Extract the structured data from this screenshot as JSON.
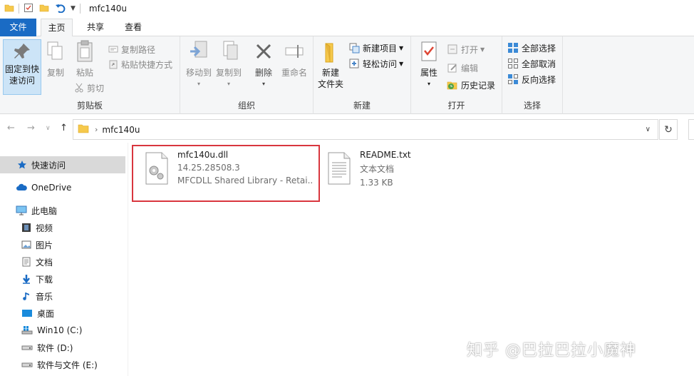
{
  "window": {
    "title": "mfc140u"
  },
  "tabs": {
    "file": "文件",
    "home": "主页",
    "share": "共享",
    "view": "查看"
  },
  "ribbon": {
    "clipboard": {
      "label": "剪贴板",
      "pin": "固定到快速访问",
      "pin_line1": "固定到快",
      "pin_line2": "速访问",
      "copy": "复制",
      "paste": "粘贴",
      "copy_path": "复制路径",
      "paste_shortcut": "粘贴快捷方式",
      "cut": "剪切"
    },
    "organize": {
      "label": "组织",
      "move_to": "移动到",
      "copy_to": "复制到",
      "delete": "删除",
      "rename": "重命名"
    },
    "new": {
      "label": "新建",
      "new_folder_line1": "新建",
      "new_folder_line2": "文件夹",
      "new_item": "新建项目",
      "easy_access": "轻松访问"
    },
    "open": {
      "label": "打开",
      "properties": "属性",
      "open": "打开",
      "edit": "编辑",
      "history": "历史记录"
    },
    "select": {
      "label": "选择",
      "select_all": "全部选择",
      "select_none": "全部取消",
      "invert": "反向选择"
    }
  },
  "address": {
    "path": "mfc140u"
  },
  "nav": {
    "quick_access": "快速访问",
    "onedrive": "OneDrive",
    "this_pc": "此电脑",
    "videos": "视频",
    "pictures": "图片",
    "documents": "文档",
    "downloads": "下载",
    "music": "音乐",
    "desktop": "桌面",
    "drive_c": "Win10 (C:)",
    "drive_d": "软件 (D:)",
    "drive_e": "软件与文件 (E:)"
  },
  "files": [
    {
      "name": "mfc140u.dll",
      "meta1": "14.25.28508.3",
      "meta2": "MFCDLL Shared Library - Retai...",
      "icon": "dll-gear-icon",
      "highlighted": true
    },
    {
      "name": "README.txt",
      "meta1": "文本文档",
      "meta2": "1.33 KB",
      "icon": "text-document-icon",
      "highlighted": false
    }
  ],
  "watermark": "知乎 @巴拉巴拉小魔神",
  "colors": {
    "accent": "#1a6bc4",
    "highlight_border": "#d9363e",
    "folder": "#f6c94c",
    "selected_nav": "#d9d9d9"
  }
}
